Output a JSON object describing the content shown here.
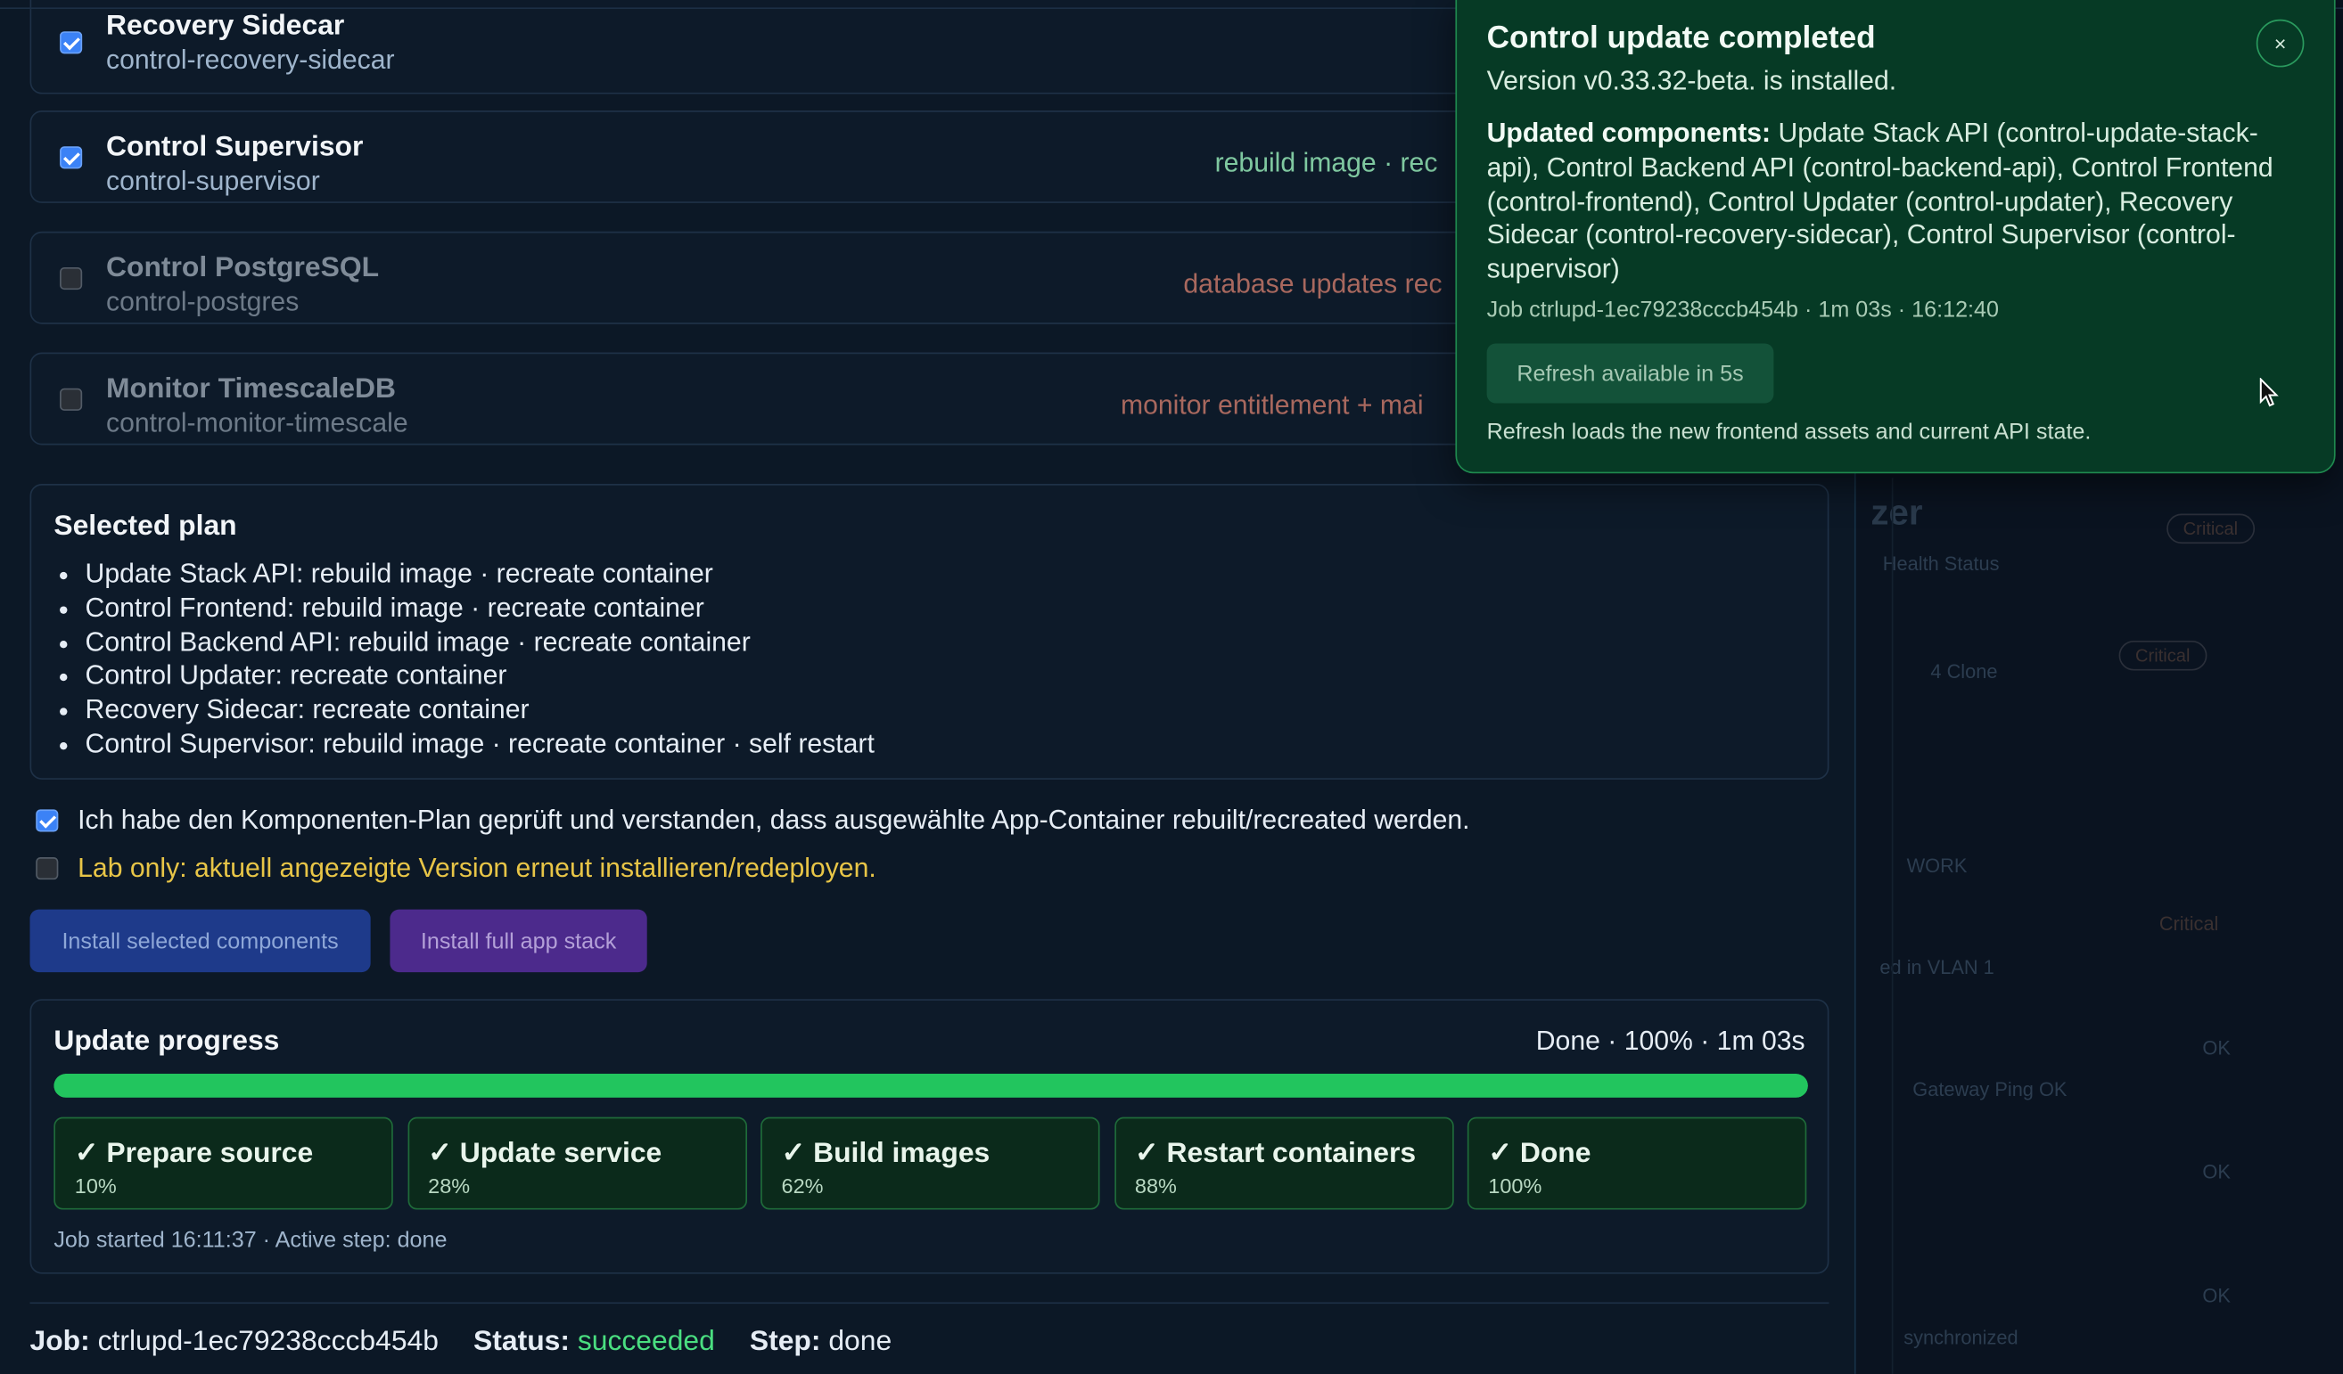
{
  "components": [
    {
      "name": "Recovery Sidecar",
      "id": "control-recovery-sidecar",
      "checked": true,
      "action": ""
    },
    {
      "name": "Control Supervisor",
      "id": "control-supervisor",
      "checked": true,
      "action": "rebuild image · rec"
    },
    {
      "name": "Control PostgreSQL",
      "id": "control-postgres",
      "checked": false,
      "action": "database updates rec"
    },
    {
      "name": "Monitor TimescaleDB",
      "id": "control-monitor-timescale",
      "checked": false,
      "action": "monitor entitlement + mai"
    }
  ],
  "plan": {
    "title": "Selected plan",
    "items": [
      "Update Stack API: rebuild image · recreate container",
      "Control Frontend: rebuild image · recreate container",
      "Control Backend API: rebuild image · recreate container",
      "Control Updater: recreate container",
      "Recovery Sidecar: recreate container",
      "Control Supervisor: rebuild image · recreate container · self restart"
    ]
  },
  "confirm": {
    "ack_label": "Ich habe den Komponenten-Plan geprüft und verstanden, dass ausgewählte App-Container rebuilt/recreated werden.",
    "ack_checked": true,
    "lab_label": "Lab only: aktuell angezeigte Version erneut installieren/redeployen.",
    "lab_checked": false
  },
  "buttons": {
    "install_selected": "Install selected components",
    "install_full": "Install full app stack"
  },
  "progress": {
    "title": "Update progress",
    "summary": "Done · 100% · 1m 03s",
    "percent": 100,
    "steps": [
      {
        "label": "✓ Prepare source",
        "pct": "10%"
      },
      {
        "label": "✓ Update service",
        "pct": "28%"
      },
      {
        "label": "✓ Build images",
        "pct": "62%"
      },
      {
        "label": "✓ Restart containers",
        "pct": "88%"
      },
      {
        "label": "✓ Done",
        "pct": "100%"
      }
    ],
    "footer": "Job started 16:11:37 · Active step: done"
  },
  "jobline": {
    "job_label": "Job:",
    "job_value": "ctrlupd-1ec79238cccb454b",
    "status_label": "Status:",
    "status_value": "succeeded",
    "step_label": "Step:",
    "step_value": "done"
  },
  "toast": {
    "title": "Control update completed",
    "version": "Version v0.33.32-beta. is installed.",
    "updated_label": "Updated components:",
    "updated_list": "Update Stack API (control-update-stack-api), Control Backend API (control-backend-api), Control Frontend (control-frontend), Control Updater (control-updater), Recovery Sidecar (control-recovery-sidecar), Control Supervisor (control-supervisor)",
    "job": "Job ctrlupd-1ec79238cccb454b · 1m 03s · 16:12:40",
    "refresh_button": "Refresh available in 5s",
    "note": "Refresh loads the new frontend assets and current API state.",
    "close": "×"
  },
  "background": {
    "title_fragment": "zer",
    "sub_fragment": "Health Status",
    "badges": [
      "Critical",
      "Critical",
      "Critical"
    ],
    "clone_text": "4 Clone",
    "work_text": "WORK",
    "vlan_text": "ed in VLAN 1",
    "ok_labels": [
      "OK",
      "OK",
      "OK"
    ],
    "gateway_text": "Gateway Ping OK",
    "sync_text": "synchronized"
  },
  "colors": {
    "accent_blue": "#3b82f6",
    "progress_green": "#22c55e",
    "toast_bg": "#063a25",
    "status_ok": "#4ade80",
    "lab_warning": "#e8c547"
  }
}
